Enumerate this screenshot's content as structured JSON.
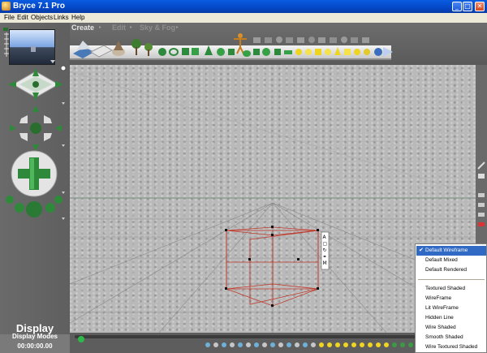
{
  "window": {
    "title": "Bryce 7.1  Pro",
    "minimize_glyph": "_",
    "maximize_glyph": "□",
    "close_glyph": "✕"
  },
  "menubar": {
    "items": [
      "File",
      "Edit",
      "Objects",
      "Links",
      "Help"
    ]
  },
  "palette_tabs": {
    "create": "Create",
    "edit": "Edit",
    "sky_fog": "Sky & Fog",
    "arrow_glyph": "▸"
  },
  "status": {
    "title": "Display",
    "subtitle": "Display Modes",
    "timecode": "00:00:00.00"
  },
  "display_menu": {
    "groups": [
      [
        {
          "label": "Default Wireframe",
          "checked": true,
          "selected": true
        },
        {
          "label": "Default Mixed",
          "checked": false,
          "selected": false
        },
        {
          "label": "Default Rendered",
          "checked": false,
          "selected": false
        }
      ],
      [
        {
          "label": "Textured Shaded",
          "checked": false,
          "selected": false
        },
        {
          "label": "WireFrame",
          "checked": false,
          "selected": false
        },
        {
          "label": "Lit WireFrame",
          "checked": false,
          "selected": false
        },
        {
          "label": "Hidden Line",
          "checked": false,
          "selected": false
        },
        {
          "label": "Wire Shaded",
          "checked": false,
          "selected": false
        },
        {
          "label": "Smooth Shaded",
          "checked": false,
          "selected": false
        },
        {
          "label": "Wire Textured Shaded",
          "checked": false,
          "selected": false
        }
      ]
    ],
    "check_glyph": "✔"
  },
  "icons": {
    "nano_view": "nano-preview-icon",
    "trackball": "trackball-icon",
    "cross_control": "cross-control-icon",
    "camera_sphere": "camera-sphere-icon",
    "shelf": [
      "terrain-icon",
      "plane-icon",
      "rock-icon",
      "tree-icon",
      "figure-icon",
      "sphere-icon",
      "cube-icon",
      "cone-icon",
      "torus-icon",
      "light-icon"
    ]
  },
  "colors": {
    "titlebar": "#0447c7",
    "menu_highlight": "#316ac5",
    "wireframe": "#c0392b",
    "accent_green": "#2e7d32"
  }
}
